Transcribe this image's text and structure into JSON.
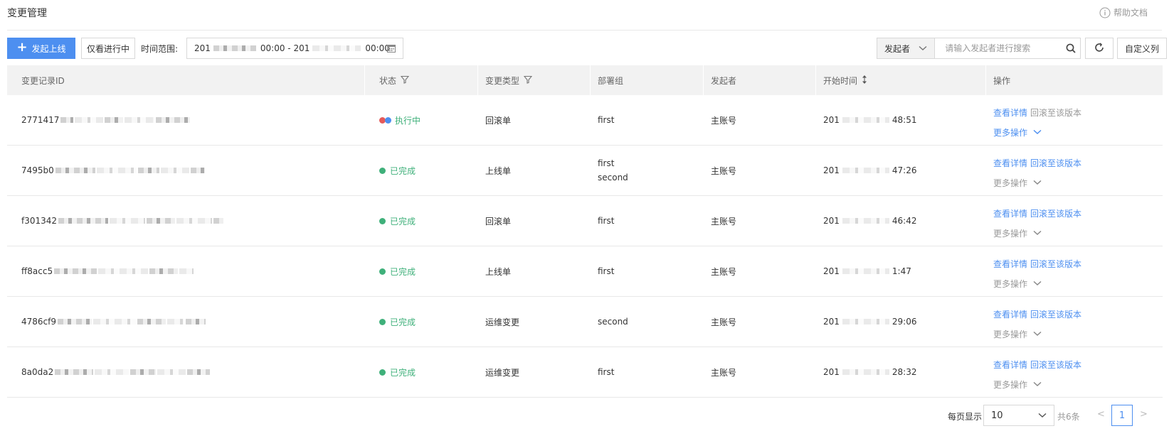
{
  "header": {
    "title": "变更管理",
    "help_label": "帮助文档"
  },
  "toolbar": {
    "launch_label": "发起上线",
    "in_progress_label": "仅看进行中",
    "time_range_label": "时间范围:",
    "date_start": "201",
    "date_start_time": "00:00 - 201",
    "date_end_time": "00:00",
    "search_filter": "发起者",
    "search_placeholder": "请输入发起者进行搜索",
    "custom_columns_label": "自定义列"
  },
  "table": {
    "headers": {
      "id": "变更记录ID",
      "status": "状态",
      "type": "变更类型",
      "team": "部署组",
      "user": "发起者",
      "time": "开始时间",
      "ops": "操作"
    },
    "rows": [
      {
        "id": "2771417",
        "status": "执行中",
        "status_icon": "running-dots-icon",
        "type": "回滚单",
        "team": [
          "first"
        ],
        "user": "主账号",
        "time_prefix": "201",
        "time_suffix": "48:51",
        "view": "查看详情",
        "rollback": "回滚至该版本",
        "rollback_enabled": false,
        "more": "更多操作",
        "more_enabled": true
      },
      {
        "id": "7495b0",
        "status": "已完成",
        "status_icon": "green-dot-icon",
        "type": "上线单",
        "team": [
          "first",
          "second"
        ],
        "user": "主账号",
        "time_prefix": "201",
        "time_suffix": "47:26",
        "view": "查看详情",
        "rollback": "回滚至该版本",
        "rollback_enabled": true,
        "more": "更多操作",
        "more_enabled": false
      },
      {
        "id": "f301342",
        "status": "已完成",
        "status_icon": "green-dot-icon",
        "type": "回滚单",
        "team": [
          "first"
        ],
        "user": "主账号",
        "time_prefix": "201",
        "time_suffix": "46:42",
        "view": "查看详情",
        "rollback": "回滚至该版本",
        "rollback_enabled": true,
        "more": "更多操作",
        "more_enabled": false
      },
      {
        "id": "ff8acc5",
        "status": "已完成",
        "status_icon": "green-dot-icon",
        "type": "上线单",
        "team": [
          "first"
        ],
        "user": "主账号",
        "time_prefix": "201",
        "time_suffix": "1:47",
        "view": "查看详情",
        "rollback": "回滚至该版本",
        "rollback_enabled": true,
        "more": "更多操作",
        "more_enabled": false
      },
      {
        "id": "4786cf9",
        "status": "已完成",
        "status_icon": "green-dot-icon",
        "type": "运维变更",
        "team": [
          "second"
        ],
        "user": "主账号",
        "time_prefix": "201",
        "time_suffix": "29:06",
        "view": "查看详情",
        "rollback": "回滚至该版本",
        "rollback_enabled": true,
        "more": "更多操作",
        "more_enabled": false
      },
      {
        "id": "8a0da2",
        "status": "已完成",
        "status_icon": "green-dot-icon",
        "type": "运维变更",
        "team": [
          "first"
        ],
        "user": "主账号",
        "time_prefix": "201",
        "time_suffix": "28:32",
        "view": "查看详情",
        "rollback": "回滚至该版本",
        "rollback_enabled": true,
        "more": "更多操作",
        "more_enabled": false
      }
    ]
  },
  "pagination": {
    "per_page_label": "每页显示",
    "per_page_value": "10",
    "total": "共6条",
    "prev": "<",
    "current": "1",
    "next": ">"
  },
  "colors": {
    "primary": "#4d8ff0",
    "success": "#3fb07a",
    "running_red": "#e55a5a",
    "running_blue": "#4d8ff0"
  }
}
